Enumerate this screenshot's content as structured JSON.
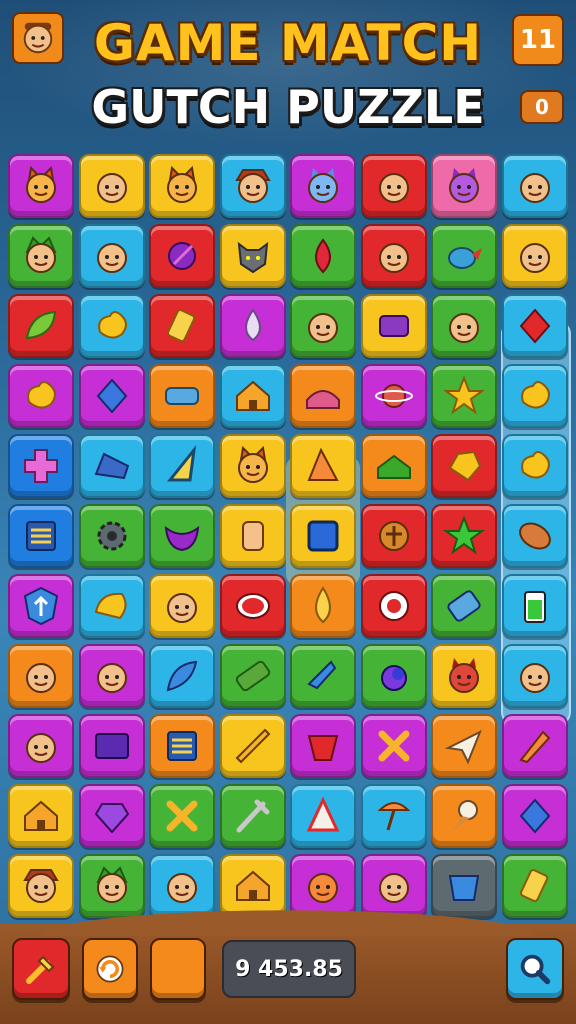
{
  "title": {
    "line1": "GAME MATCH",
    "line2": "GUTCH PUZZLE"
  },
  "hud": {
    "level": "11",
    "coins": "0",
    "score": "9 453.85"
  },
  "icons": {
    "avatar": "face-icon",
    "hammer": "hammer-icon",
    "refresh": "refresh-icon",
    "blank": "blank-icon",
    "search": "magnifier-icon"
  },
  "colors": {
    "magenta": "#c72fd6",
    "yellow": "#f7c51d",
    "cyan": "#2eb5e8",
    "red": "#e1282a",
    "pink": "#ee6aa8",
    "green": "#45b336",
    "orange": "#f58a1c",
    "blue": "#1f7ee0",
    "gray": "#5d6b70"
  },
  "board": {
    "rows": [
      [
        {
          "c": "magenta",
          "i": "cat-face"
        },
        {
          "c": "yellow",
          "i": "glasses-face"
        },
        {
          "c": "yellow",
          "i": "cat-face"
        },
        {
          "c": "cyan",
          "i": "hat-face"
        },
        {
          "c": "magenta",
          "i": "blue-cat"
        },
        {
          "c": "red",
          "i": "glasses-face"
        },
        {
          "c": "pink",
          "i": "purple-cat"
        },
        {
          "c": "cyan",
          "i": "glasses-face"
        }
      ],
      [
        {
          "c": "green",
          "i": "elf-face"
        },
        {
          "c": "cyan",
          "i": "face"
        },
        {
          "c": "red",
          "i": "purple-ball"
        },
        {
          "c": "yellow",
          "i": "wolf"
        },
        {
          "c": "green",
          "i": "red-blob"
        },
        {
          "c": "red",
          "i": "glasses-face"
        },
        {
          "c": "green",
          "i": "bird"
        },
        {
          "c": "yellow",
          "i": "face"
        }
      ],
      [
        {
          "c": "red",
          "i": "leaf"
        },
        {
          "c": "cyan",
          "i": "yellow-star-blob"
        },
        {
          "c": "red",
          "i": "yellow-bar"
        },
        {
          "c": "magenta",
          "i": "drop"
        },
        {
          "c": "green",
          "i": "green-face"
        },
        {
          "c": "yellow",
          "i": "purple-box"
        },
        {
          "c": "green",
          "i": "green-face"
        },
        {
          "c": "cyan",
          "i": "red-gem"
        }
      ],
      [
        {
          "c": "magenta",
          "i": "yellow-blob"
        },
        {
          "c": "magenta",
          "i": "blue-gem"
        },
        {
          "c": "orange",
          "i": "blue-bar"
        },
        {
          "c": "cyan",
          "i": "house"
        },
        {
          "c": "orange",
          "i": "cake"
        },
        {
          "c": "magenta",
          "i": "planet"
        },
        {
          "c": "green",
          "i": "star"
        },
        {
          "c": "cyan",
          "i": "yellow-blob"
        }
      ],
      [
        {
          "c": "blue",
          "i": "pink-cross"
        },
        {
          "c": "cyan",
          "i": "blue-shoe"
        },
        {
          "c": "cyan",
          "i": "triangle"
        },
        {
          "c": "yellow",
          "i": "cat-face"
        },
        {
          "c": "yellow",
          "i": "cheese"
        },
        {
          "c": "orange",
          "i": "green-house"
        },
        {
          "c": "red",
          "i": "gold-nugget"
        },
        {
          "c": "cyan",
          "i": "yellow-blob"
        }
      ],
      [
        {
          "c": "blue",
          "i": "list"
        },
        {
          "c": "green",
          "i": "gear"
        },
        {
          "c": "green",
          "i": "purple-mask"
        },
        {
          "c": "yellow",
          "i": "jar"
        },
        {
          "c": "yellow",
          "i": "tablet"
        },
        {
          "c": "red",
          "i": "cross-coin"
        },
        {
          "c": "red",
          "i": "green-star"
        },
        {
          "c": "cyan",
          "i": "cookie"
        }
      ],
      [
        {
          "c": "magenta",
          "i": "arrow-shield"
        },
        {
          "c": "cyan",
          "i": "yellow-shell"
        },
        {
          "c": "yellow",
          "i": "face"
        },
        {
          "c": "red",
          "i": "red-button"
        },
        {
          "c": "orange",
          "i": "gold-drop"
        },
        {
          "c": "red",
          "i": "target"
        },
        {
          "c": "green",
          "i": "battery"
        },
        {
          "c": "cyan",
          "i": "green-battery"
        }
      ],
      [
        {
          "c": "orange",
          "i": "face"
        },
        {
          "c": "magenta",
          "i": "face"
        },
        {
          "c": "cyan",
          "i": "blue-feather"
        },
        {
          "c": "green",
          "i": "green-bar"
        },
        {
          "c": "green",
          "i": "plane"
        },
        {
          "c": "green",
          "i": "blue-ring"
        },
        {
          "c": "yellow",
          "i": "red-devil"
        },
        {
          "c": "cyan",
          "i": "glasses-face"
        }
      ],
      [
        {
          "c": "magenta",
          "i": "face"
        },
        {
          "c": "magenta",
          "i": "screen"
        },
        {
          "c": "orange",
          "i": "blue-list"
        },
        {
          "c": "yellow",
          "i": "ruler"
        },
        {
          "c": "magenta",
          "i": "red-cup"
        },
        {
          "c": "magenta",
          "i": "cross"
        },
        {
          "c": "orange",
          "i": "paper-plane"
        },
        {
          "c": "magenta",
          "i": "brush"
        }
      ],
      [
        {
          "c": "yellow",
          "i": "house"
        },
        {
          "c": "magenta",
          "i": "purple-gem"
        },
        {
          "c": "green",
          "i": "x-mark"
        },
        {
          "c": "green",
          "i": "sword"
        },
        {
          "c": "cyan",
          "i": "cone"
        },
        {
          "c": "cyan",
          "i": "lamp"
        },
        {
          "c": "orange",
          "i": "ice-cream"
        },
        {
          "c": "magenta",
          "i": "blue-gem"
        }
      ],
      [
        {
          "c": "yellow",
          "i": "hat-face"
        },
        {
          "c": "green",
          "i": "elf-face"
        },
        {
          "c": "cyan",
          "i": "face"
        },
        {
          "c": "yellow",
          "i": "house"
        },
        {
          "c": "magenta",
          "i": "egg-face"
        },
        {
          "c": "magenta",
          "i": "face"
        },
        {
          "c": "gray",
          "i": "bucket"
        },
        {
          "c": "green",
          "i": "gold-bar"
        }
      ]
    ]
  }
}
